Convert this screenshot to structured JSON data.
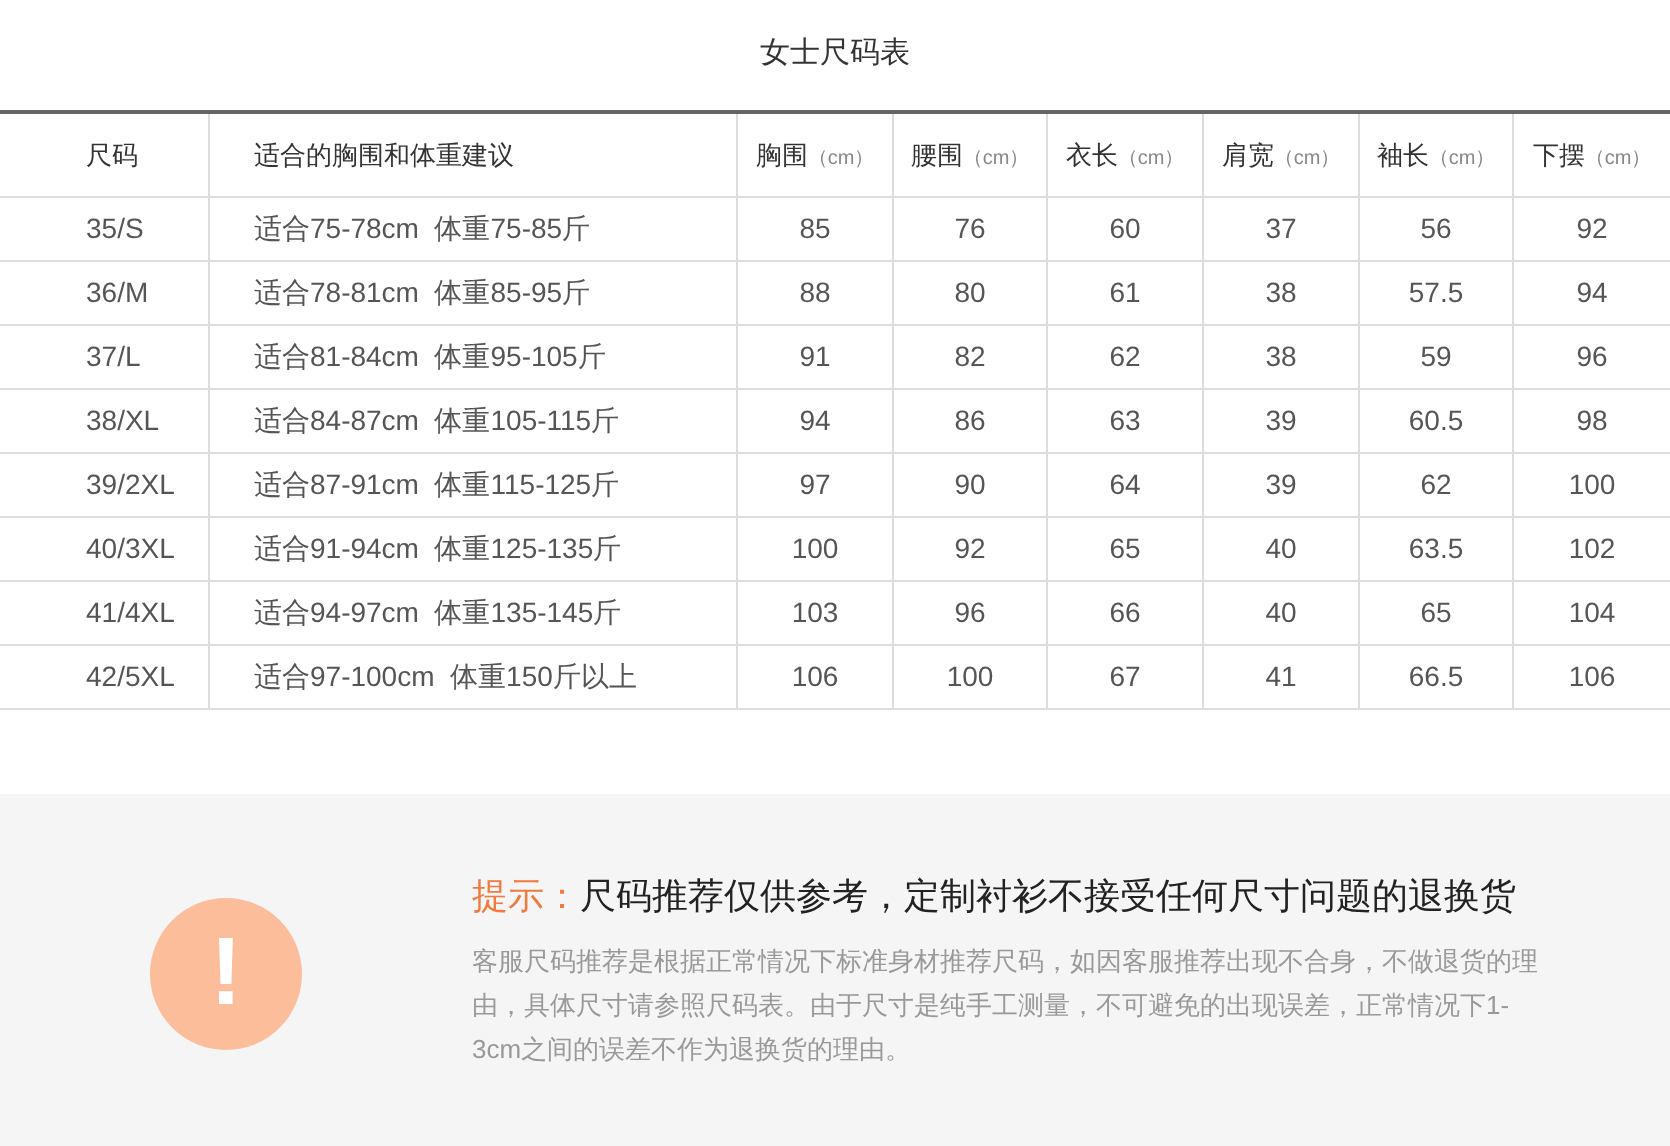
{
  "title": "女士尺码表",
  "table": {
    "columns": [
      {
        "label": "尺码"
      },
      {
        "label": "适合的胸围和体重建议"
      },
      {
        "label": "胸围",
        "unit": "（cm）"
      },
      {
        "label": "腰围",
        "unit": "（cm）"
      },
      {
        "label": "衣长",
        "unit": "（cm）"
      },
      {
        "label": "肩宽",
        "unit": "（cm）"
      },
      {
        "label": "袖长",
        "unit": "（cm）"
      },
      {
        "label": "下摆",
        "unit": "（cm）"
      }
    ],
    "rows": [
      [
        "35/S",
        "适合75-78cm  体重75-85斤",
        "85",
        "76",
        "60",
        "37",
        "56",
        "92"
      ],
      [
        "36/M",
        "适合78-81cm  体重85-95斤",
        "88",
        "80",
        "61",
        "38",
        "57.5",
        "94"
      ],
      [
        "37/L",
        "适合81-84cm  体重95-105斤",
        "91",
        "82",
        "62",
        "38",
        "59",
        "96"
      ],
      [
        "38/XL",
        "适合84-87cm  体重105-115斤",
        "94",
        "86",
        "63",
        "39",
        "60.5",
        "98"
      ],
      [
        "39/2XL",
        "适合87-91cm  体重115-125斤",
        "97",
        "90",
        "64",
        "39",
        "62",
        "100"
      ],
      [
        "40/3XL",
        "适合91-94cm  体重125-135斤",
        "100",
        "92",
        "65",
        "40",
        "63.5",
        "102"
      ],
      [
        "41/4XL",
        "适合94-97cm  体重135-145斤",
        "103",
        "96",
        "66",
        "40",
        "65",
        "104"
      ],
      [
        "42/5XL",
        "适合97-100cm  体重150斤以上",
        "106",
        "100",
        "67",
        "41",
        "66.5",
        "106"
      ]
    ]
  },
  "notice": {
    "icon": "!",
    "prefix": "提示：",
    "heading": "尺码推荐仅供参考，定制衬衫不接受任何尺寸问题的退换货",
    "body": "客服尺码推荐是根据正常情况下标准身材推荐尺码，如因客服推荐出现不合身，不做退货的理由，具体尺寸请参照尺码表。由于尺寸是纯手工测量，不可避免的出现误差，正常情况下1-3cm之间的误差不作为退换货的理由。"
  }
}
